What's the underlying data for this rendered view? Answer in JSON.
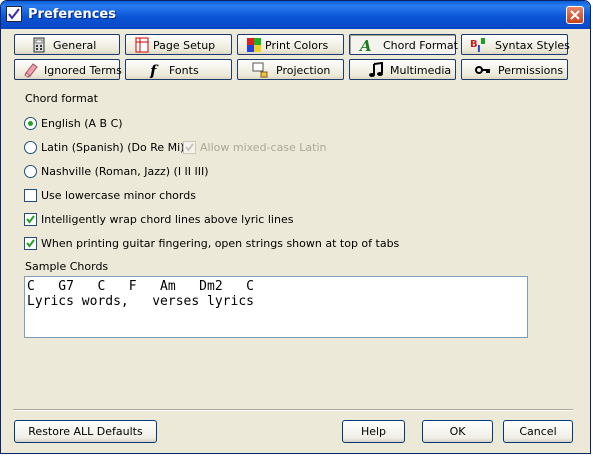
{
  "window": {
    "title": "Preferences"
  },
  "tabs": [
    {
      "label": "General",
      "icon": "calculator-icon"
    },
    {
      "label": "Page Setup",
      "icon": "page-setup-icon"
    },
    {
      "label": "Print Colors",
      "icon": "color-squares-icon"
    },
    {
      "label": "Chord Format",
      "icon": "chord-a-icon",
      "active": true
    },
    {
      "label": "Syntax Styles",
      "icon": "syntax-styles-icon"
    },
    {
      "label": "Ignored Terms",
      "icon": "eraser-icon"
    },
    {
      "label": "Fonts",
      "icon": "font-f-icon"
    },
    {
      "label": "Projection",
      "icon": "projection-icon"
    },
    {
      "label": "Multimedia",
      "icon": "music-note-icon"
    },
    {
      "label": "Permissions",
      "icon": "key-icon"
    }
  ],
  "chord_format": {
    "heading": "Chord format",
    "options": {
      "english": {
        "label": "English   (A B C)",
        "selected": true
      },
      "latin": {
        "label": "Latin   (Spanish) (Do Re Mi)",
        "selected": false
      },
      "nashville": {
        "label": "Nashville   (Roman, Jazz) (I II III)",
        "selected": false
      }
    },
    "allow_mixed_case": {
      "label": "Allow mixed-case Latin",
      "checked": true,
      "enabled": false
    }
  },
  "checkboxes": {
    "lowercase_minor": {
      "label": "Use lowercase minor chords",
      "checked": false
    },
    "wrap_chords": {
      "label": "Intelligently wrap chord lines above lyric lines",
      "checked": true
    },
    "guitar_fingering": {
      "label": "When printing guitar fingering, open strings shown at top of tabs",
      "checked": true
    }
  },
  "sample": {
    "heading": "Sample Chords",
    "chord_line": "C   G7   C   F   Am   Dm2   C",
    "lyric_line": "Lyrics words,   verses lyrics"
  },
  "buttons": {
    "restore": "Restore ALL Defaults",
    "help": "Help",
    "ok": "OK",
    "cancel": "Cancel"
  },
  "colors": {
    "titlebar": "#0a5fd8",
    "dialog_bg": "#ece9d8",
    "radio_dot": "#21a121",
    "check_mark": "#21a121"
  }
}
